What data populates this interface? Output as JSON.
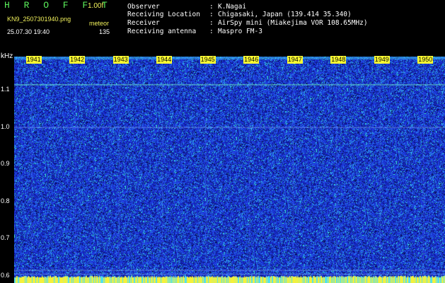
{
  "header": {
    "app_title": "H R O F F T",
    "version": "1.00f",
    "filename": "KN9_2507301940.png",
    "mode": "meteor",
    "datetime": "25.07.30 19:40",
    "count": "135"
  },
  "info": [
    {
      "label": "Observer",
      "value": "K.Nagai"
    },
    {
      "label": "Receiving Location",
      "value": "Chigasaki, Japan (139.414 35.340)"
    },
    {
      "label": "Receiver",
      "value": "AirSpy mini (Miakejima VOR 108.65MHz)"
    },
    {
      "label": "Receiving antenna",
      "value": "Maspro FM-3"
    }
  ],
  "chart_data": {
    "type": "heatmap",
    "ylabel": "kHz",
    "y_ticks": [
      "1.1",
      "1.0",
      "0.9",
      "0.8",
      "0.7",
      "0.6"
    ],
    "x_ticks": [
      "1941",
      "1942",
      "1943",
      "1944",
      "1945",
      "1946",
      "1947",
      "1948",
      "1949",
      "1950"
    ],
    "ylim": [
      0.58,
      1.19
    ],
    "xlim": [
      1940.6,
      1950.5
    ],
    "colors": {
      "background": "#1a2fc8",
      "noise_dark": "#0a0f60",
      "noise_bright": "#3cf2e6",
      "axis_label_bg": "#ffff33"
    }
  }
}
